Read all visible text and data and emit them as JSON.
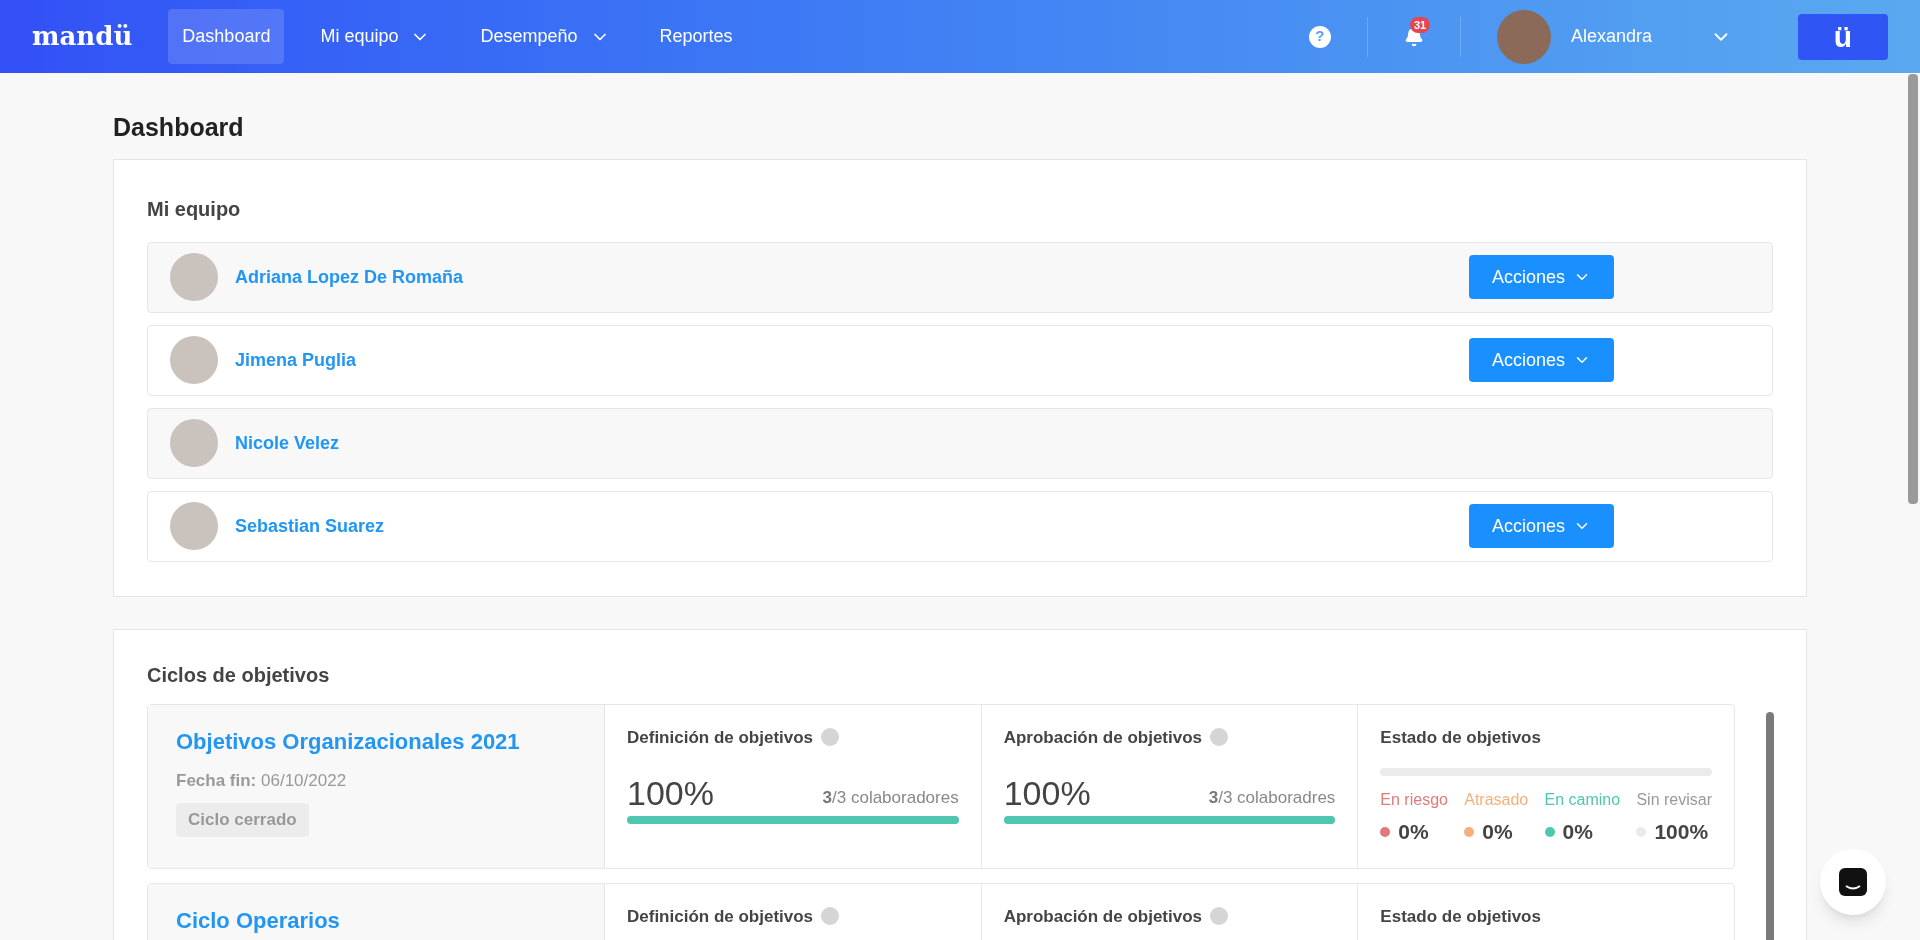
{
  "nav": {
    "logo": "mandü",
    "items": [
      {
        "label": "Dashboard",
        "selected": true,
        "dropdown": false
      },
      {
        "label": "Mi equipo",
        "selected": false,
        "dropdown": true
      },
      {
        "label": "Desempeño",
        "selected": false,
        "dropdown": true
      },
      {
        "label": "Reportes",
        "selected": false,
        "dropdown": false
      }
    ],
    "help": "?",
    "notifications": "31",
    "user": "Alexandra",
    "brand_button": "ü"
  },
  "page_title": "Dashboard",
  "team": {
    "title": "Mi equipo",
    "members": [
      {
        "name": "Adriana Lopez De Romaña",
        "action": "Acciones"
      },
      {
        "name": "Jimena Puglia",
        "action": "Acciones"
      },
      {
        "name": "Nicole Velez"
      },
      {
        "name": "Sebastian Suarez",
        "action": "Acciones"
      }
    ]
  },
  "cycles": {
    "title": "Ciclos de objetivos",
    "items": [
      {
        "title": "Objetivos Organizacionales 2021",
        "date_label": "Fecha fin:",
        "date": "06/10/2022",
        "status": "Ciclo cerrado",
        "stages": [
          {
            "title": "Definición de objetivos",
            "percent": "100%",
            "done": "3",
            "rest": "/3 colaboradores",
            "level": 1
          },
          {
            "title": "Aprobación de objetivos",
            "percent": "100%",
            "done": "3",
            "rest": "/3 colaboradres",
            "level": 1
          }
        ],
        "state": {
          "title": "Estado de objetivos",
          "legend": [
            {
              "label": "En riesgo",
              "value": "0%",
              "color": "#e07a7a"
            },
            {
              "label": "Atrasado",
              "value": "0%",
              "color": "#f4b07a"
            },
            {
              "label": "En camino",
              "value": "0%",
              "color": "#4fc6b0"
            },
            {
              "label": "Sin revisar",
              "value": "100%",
              "color": "#ebe9ea"
            }
          ]
        }
      },
      {
        "title": "Ciclo Operarios",
        "stages": [
          {
            "title": "Definición de objetivos"
          },
          {
            "title": "Aprobación de objetivos"
          }
        ],
        "state": {
          "title": "Estado de objetivos"
        }
      }
    ]
  }
}
